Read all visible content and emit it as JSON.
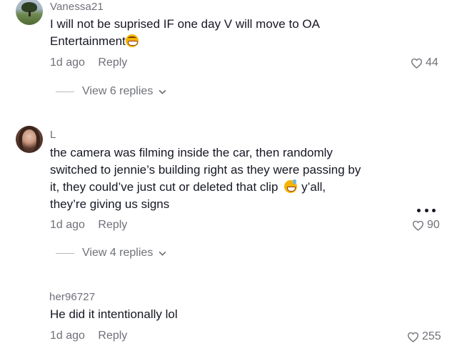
{
  "comments": [
    {
      "username": "Vanessa21",
      "text_line1": "I will not be suprised IF one day V will move to OA",
      "text_line2": "Entertainment",
      "emoji": "grinning-face-emoji",
      "time": "1d ago",
      "reply_label": "Reply",
      "likes": "44",
      "view_replies": "View 6 replies"
    },
    {
      "username": "L",
      "text_line1": "the camera was filming inside the car, then randomly",
      "text_line2": "switched to jennie’s building right as they were passing by",
      "text_line3a": "it, they could’ve just cut or deleted that clip",
      "text_line3b": "y’all,",
      "text_line4": "they’re giving us signs",
      "emoji": "grinning-sweat-emoji",
      "time": "1d ago",
      "reply_label": "Reply",
      "likes": "90",
      "view_replies": "View 4 replies"
    },
    {
      "username": "her96727",
      "text_line1": "He did it intentionally lol",
      "time": "1d ago",
      "reply_label": "Reply",
      "likes": "255"
    }
  ],
  "colors": {
    "primary_text": "#161823",
    "secondary_text": "#6f7178"
  }
}
